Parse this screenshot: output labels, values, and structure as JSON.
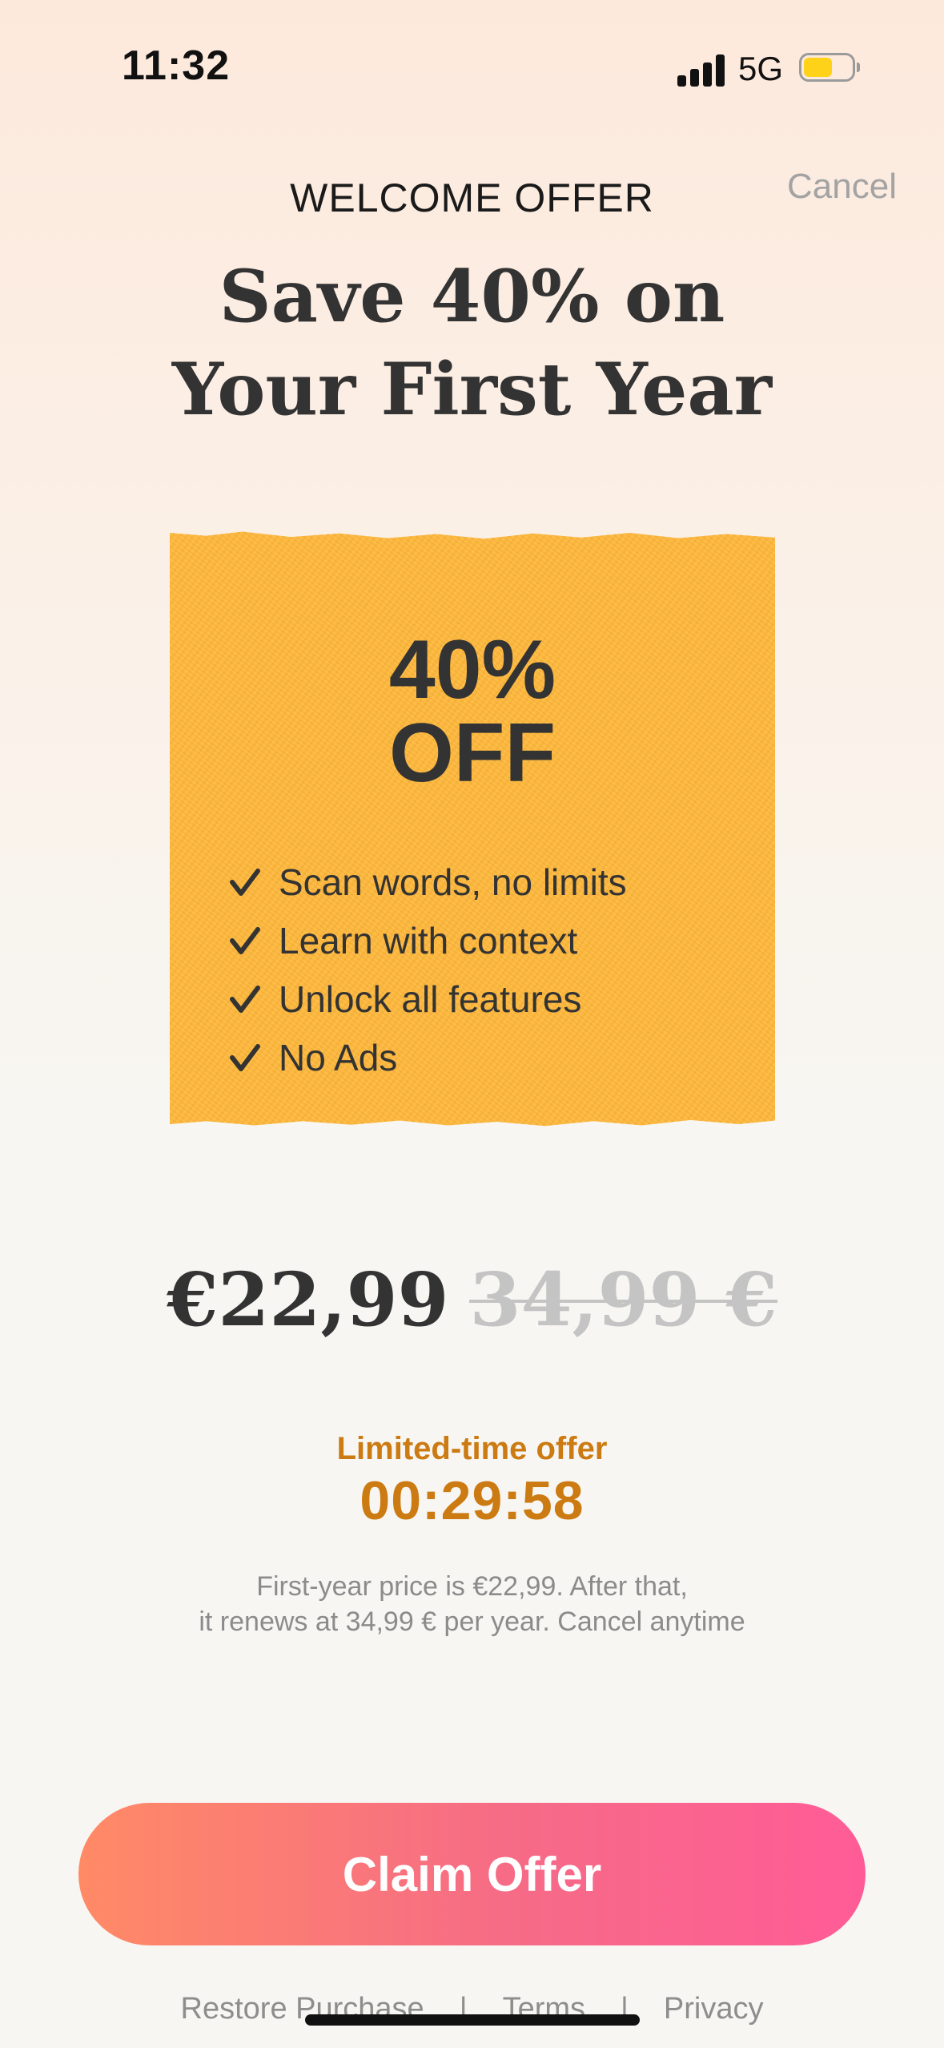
{
  "status_bar": {
    "time": "11:32",
    "network": "5G",
    "battery_level": 0.6,
    "battery_color": "#ffd21a"
  },
  "header": {
    "eyebrow": "WELCOME OFFER",
    "cancel_label": "Cancel",
    "headline_line1": "Save 40% on",
    "headline_line2": "Your First Year"
  },
  "card": {
    "discount_value": "40%",
    "discount_word": "OFF",
    "color": "#ffb83a",
    "features": [
      {
        "icon": "check-icon",
        "label": "Scan words, no limits"
      },
      {
        "icon": "check-icon",
        "label": "Learn with context"
      },
      {
        "icon": "check-icon",
        "label": "Unlock all features"
      },
      {
        "icon": "check-icon",
        "label": "No Ads"
      }
    ]
  },
  "pricing": {
    "new_price": "€22,99",
    "old_price": "34,99 €",
    "limited_label": "Limited-time offer",
    "countdown": "00:29:58",
    "disclaimer_line1": "First-year price is €22,99. After that,",
    "disclaimer_line2": "it renews at 34,99 € per year. Cancel anytime"
  },
  "cta": {
    "label": "Claim Offer",
    "gradient_start": "#ff8a66",
    "gradient_end": "#ff5c97"
  },
  "footer": {
    "restore_label": "Restore Purchase",
    "terms_label": "Terms",
    "privacy_label": "Privacy",
    "separator": "|"
  }
}
